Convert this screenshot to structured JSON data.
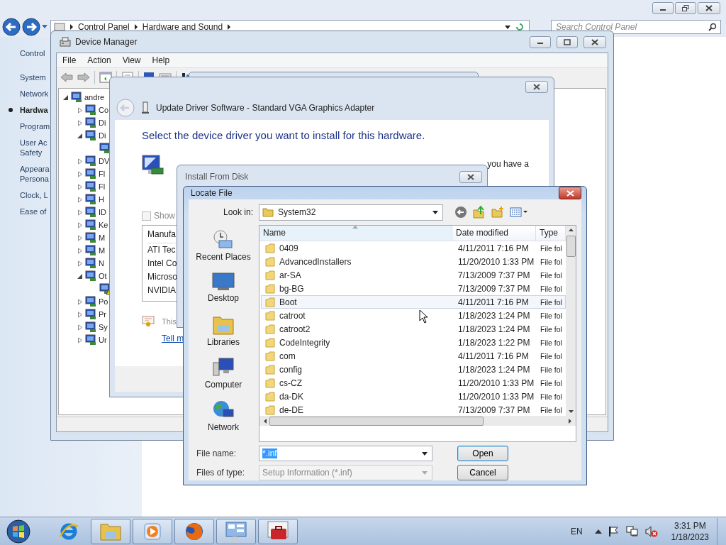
{
  "control_panel": {
    "address": [
      "Control Panel",
      "Hardware and Sound"
    ],
    "search": {
      "placeholder": "Search Control Panel"
    },
    "home_link": "Control",
    "sidebar": [
      {
        "lines": [
          "System"
        ],
        "selected": false
      },
      {
        "lines": [
          "Network"
        ],
        "selected": false
      },
      {
        "lines": [
          "Hardwa"
        ],
        "selected": true
      },
      {
        "lines": [
          "Program"
        ],
        "selected": false
      },
      {
        "lines": [
          "User Ac",
          "Safety"
        ],
        "selected": false
      },
      {
        "lines": [
          "Appeara",
          "Persona"
        ],
        "selected": false
      },
      {
        "lines": [
          "Clock, L"
        ],
        "selected": false
      },
      {
        "lines": [
          "Ease of"
        ],
        "selected": false
      }
    ]
  },
  "device_manager": {
    "title": "Device Manager",
    "menu": [
      "File",
      "Action",
      "View",
      "Help"
    ],
    "tree": {
      "label": "andre",
      "expanded": true,
      "children": [
        {
          "label": "Co",
          "expanded": false
        },
        {
          "label": "Di",
          "expanded": false
        },
        {
          "label": "Di",
          "expanded": true,
          "children": [
            {
              "warning": false
            }
          ]
        },
        {
          "label": "DV",
          "expanded": false
        },
        {
          "label": "Fl",
          "expanded": false
        },
        {
          "label": "Fl",
          "expanded": false
        },
        {
          "label": "H",
          "expanded": false
        },
        {
          "label": "ID",
          "expanded": false
        },
        {
          "label": "Ke",
          "expanded": false
        },
        {
          "label": "M",
          "expanded": false
        },
        {
          "label": "M",
          "expanded": false
        },
        {
          "label": "N",
          "expanded": false
        },
        {
          "label": "Ot",
          "expanded": true,
          "children": [
            {
              "warning": true
            }
          ]
        },
        {
          "label": "Po",
          "expanded": false
        },
        {
          "label": "Pr",
          "expanded": false
        },
        {
          "label": "Sy",
          "expanded": false
        },
        {
          "label": "Ur",
          "expanded": false
        }
      ]
    }
  },
  "update_driver": {
    "title": "Update Driver Software - Standard VGA Graphics Adapter",
    "heading": "Select the device driver you want to install for this hardware.",
    "instruction_tail": "you have a",
    "show_compatible": {
      "label": "Show",
      "checked": false
    },
    "list": {
      "header": "Manufa",
      "rows": [
        "ATI Tec",
        "Intel Co",
        "Microso",
        "NVIDIA"
      ]
    },
    "signed_note": "This",
    "link": "Tell m"
  },
  "install_from_disk": {
    "title": "Install From Disk"
  },
  "locate_file": {
    "title": "Locate File",
    "look_in_label": "Look in:",
    "look_in": "System32",
    "places": [
      "Recent Places",
      "Desktop",
      "Libraries",
      "Computer",
      "Network"
    ],
    "columns": [
      "Name",
      "Date modified",
      "Type"
    ],
    "rows": [
      {
        "name": "0409",
        "date": "4/11/2011 7:16 PM",
        "type": "File fol",
        "hovered": false
      },
      {
        "name": "AdvancedInstallers",
        "date": "11/20/2010 1:33 PM",
        "type": "File fol",
        "hovered": false
      },
      {
        "name": "ar-SA",
        "date": "7/13/2009 7:37 PM",
        "type": "File fol",
        "hovered": false
      },
      {
        "name": "bg-BG",
        "date": "7/13/2009 7:37 PM",
        "type": "File fol",
        "hovered": false
      },
      {
        "name": "Boot",
        "date": "4/11/2011 7:16 PM",
        "type": "File fol",
        "hovered": true
      },
      {
        "name": "catroot",
        "date": "1/18/2023 1:24 PM",
        "type": "File fol",
        "hovered": false
      },
      {
        "name": "catroot2",
        "date": "1/18/2023 1:24 PM",
        "type": "File fol",
        "hovered": false
      },
      {
        "name": "CodeIntegrity",
        "date": "1/18/2023 1:22 PM",
        "type": "File fol",
        "hovered": false
      },
      {
        "name": "com",
        "date": "4/11/2011 7:16 PM",
        "type": "File fol",
        "hovered": false
      },
      {
        "name": "config",
        "date": "1/18/2023 1:24 PM",
        "type": "File fol",
        "hovered": false
      },
      {
        "name": "cs-CZ",
        "date": "11/20/2010 1:33 PM",
        "type": "File fol",
        "hovered": false
      },
      {
        "name": "da-DK",
        "date": "11/20/2010 1:33 PM",
        "type": "File fol",
        "hovered": false
      },
      {
        "name": "de-DE",
        "date": "7/13/2009 7:37 PM",
        "type": "File fol",
        "hovered": false
      }
    ],
    "file_name_label": "File name:",
    "file_name": {
      "value": "*.inf",
      "selected": true
    },
    "files_of_type_label": "Files of type:",
    "files_of_type": {
      "value": "Setup Information (*.inf)",
      "disabled": true
    },
    "buttons": [
      {
        "label": "Open",
        "default": true
      },
      {
        "label": "Cancel",
        "default": false
      }
    ]
  },
  "taskbar": {
    "apps": [
      {
        "running": false
      },
      {
        "running": true
      },
      {
        "running": true
      },
      {
        "running": true
      },
      {
        "running": true
      },
      {
        "running": true
      }
    ],
    "language": "EN",
    "time": "3:31 PM",
    "date": "1/18/2023"
  }
}
